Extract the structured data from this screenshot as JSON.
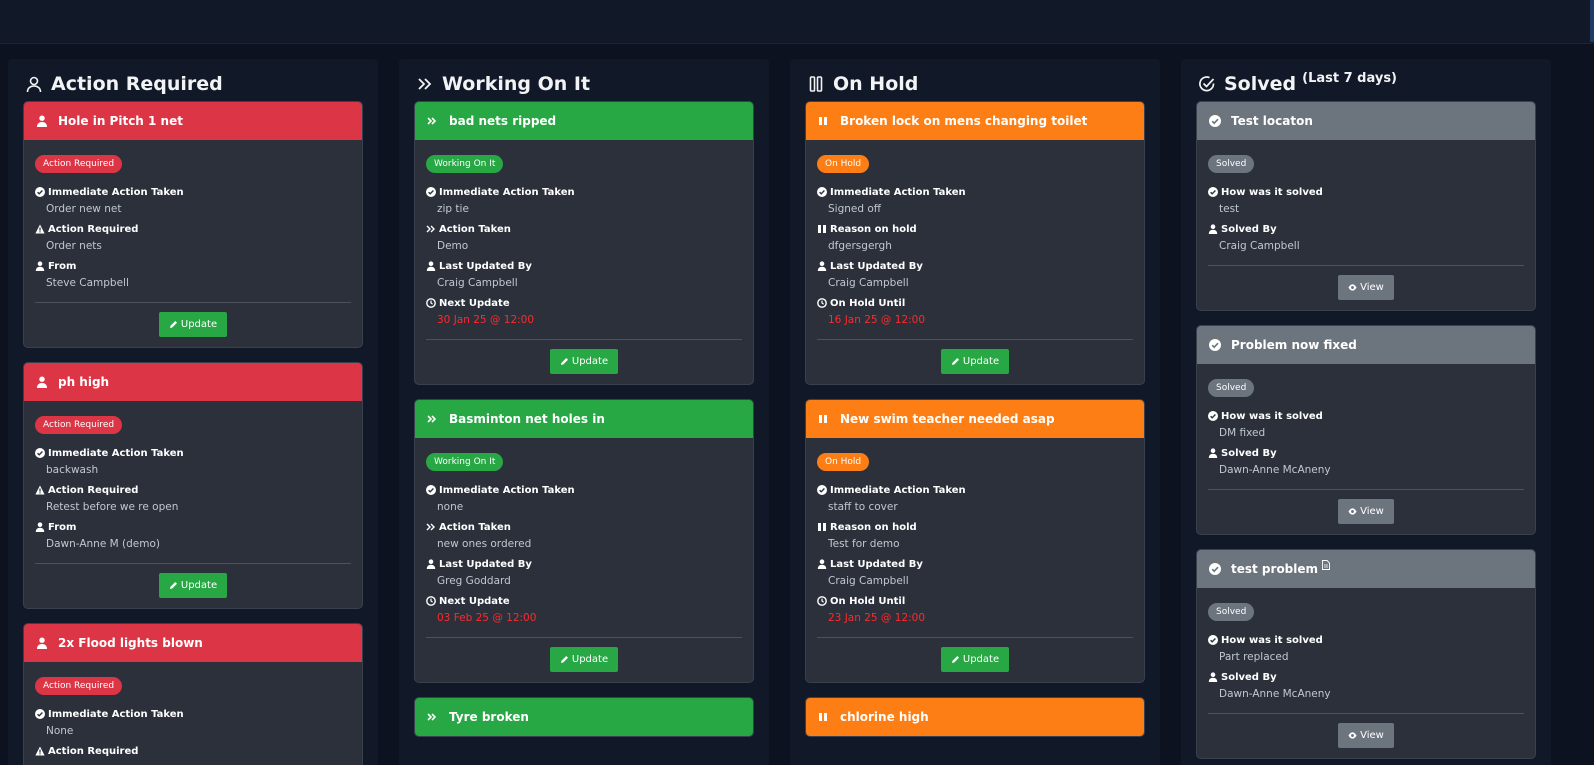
{
  "columns": {
    "action_required": {
      "title": "Action Required",
      "cards": [
        {
          "title": "Hole in Pitch 1 net",
          "badge": "Action Required",
          "f1_label": "Immediate Action Taken",
          "f1_value": "Order new net",
          "f2_label": "Action Required",
          "f2_value": "Order nets",
          "f3_label": "From",
          "f3_value": "Steve Campbell",
          "button": "Update"
        },
        {
          "title": "ph high",
          "badge": "Action Required",
          "f1_label": "Immediate Action Taken",
          "f1_value": "backwash",
          "f2_label": "Action Required",
          "f2_value": "Retest before we re open",
          "f3_label": "From",
          "f3_value": "Dawn-Anne M (demo)",
          "button": "Update"
        },
        {
          "title": "2x Flood lights blown",
          "badge": "Action Required",
          "f1_label": "Immediate Action Taken",
          "f1_value": "None",
          "f2_label": "Action Required"
        }
      ]
    },
    "working_on_it": {
      "title": "Working On It",
      "cards": [
        {
          "title": "bad nets ripped",
          "badge": "Working On It",
          "f1_label": "Immediate Action Taken",
          "f1_value": "zip tie",
          "f2_label": "Action Taken",
          "f2_value": "Demo",
          "f3_label": "Last Updated By",
          "f3_value": "Craig Campbell",
          "f4_label": "Next Update",
          "f4_value": "30 Jan 25 @ 12:00",
          "button": "Update"
        },
        {
          "title": "Basminton net holes in",
          "badge": "Working On It",
          "f1_label": "Immediate Action Taken",
          "f1_value": "none",
          "f2_label": "Action Taken",
          "f2_value": "new ones ordered",
          "f3_label": "Last Updated By",
          "f3_value": "Greg Goddard",
          "f4_label": "Next Update",
          "f4_value": "03 Feb 25 @ 12:00",
          "button": "Update"
        },
        {
          "title": "Tyre broken"
        }
      ]
    },
    "on_hold": {
      "title": "On Hold",
      "cards": [
        {
          "title": "Broken lock on mens changing toilet",
          "badge": "On Hold",
          "f1_label": "Immediate Action Taken",
          "f1_value": "Signed off",
          "f2_label": "Reason on hold",
          "f2_value": "dfgersgergh",
          "f3_label": "Last Updated By",
          "f3_value": "Craig Campbell",
          "f4_label": "On Hold Until",
          "f4_value": "16 Jan 25 @ 12:00",
          "button": "Update"
        },
        {
          "title": "New swim teacher needed asap",
          "badge": "On Hold",
          "f1_label": "Immediate Action Taken",
          "f1_value": "staff to cover",
          "f2_label": "Reason on hold",
          "f2_value": "Test for demo",
          "f3_label": "Last Updated By",
          "f3_value": "Craig Campbell",
          "f4_label": "On Hold Until",
          "f4_value": "23 Jan 25 @ 12:00",
          "button": "Update"
        },
        {
          "title": "chlorine high"
        }
      ]
    },
    "solved": {
      "title": "Solved",
      "subtitle": "(Last 7 days)",
      "cards": [
        {
          "title": "Test locaton",
          "badge": "Solved",
          "f1_label": "How was it solved",
          "f1_value": "test",
          "f2_label": "Solved By",
          "f2_value": "Craig Campbell",
          "button": "View"
        },
        {
          "title": "Problem now fixed",
          "badge": "Solved",
          "f1_label": "How was it solved",
          "f1_value": "DM fixed",
          "f2_label": "Solved By",
          "f2_value": "Dawn-Anne McAneny",
          "button": "View"
        },
        {
          "title": "test problem",
          "badge": "Solved",
          "f1_label": "How was it solved",
          "f1_value": "Part replaced",
          "f2_label": "Solved By",
          "f2_value": "Dawn-Anne McAneny",
          "button": "View"
        }
      ]
    }
  },
  "colors": {
    "action_required": "#dc3545",
    "working_on_it": "#28a745",
    "on_hold": "#fd7e14",
    "solved": "#6c757d",
    "date_text": "#ff2a2a"
  }
}
